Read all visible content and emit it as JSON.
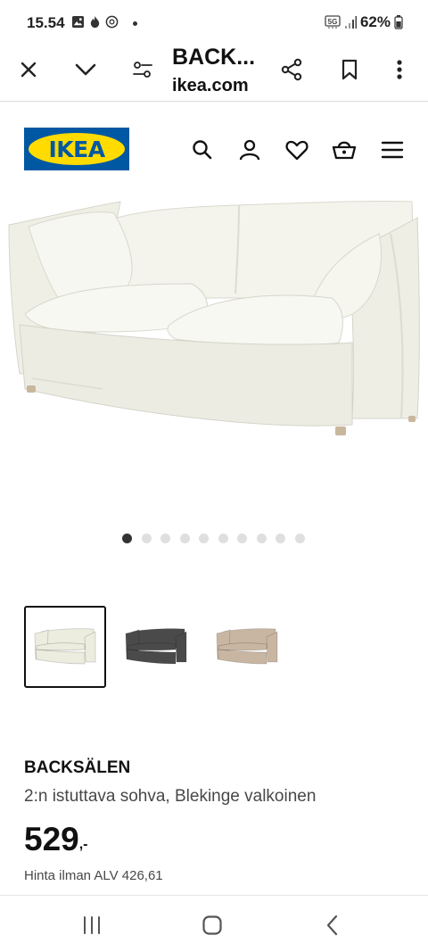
{
  "status_bar": {
    "time": "15.54",
    "network": "5G",
    "battery": "62%",
    "left_icons": [
      "gallery-icon",
      "fire-icon",
      "data-saver-icon"
    ],
    "right_icons": [
      "network-5g-icon",
      "signal-icon",
      "battery-icon"
    ]
  },
  "browser": {
    "title": "BACK...",
    "domain": "ikea.com",
    "icons": [
      "close-icon",
      "chevron-down-icon",
      "page-settings-icon",
      "share-icon",
      "bookmark-icon",
      "more-vert-icon"
    ]
  },
  "site_header": {
    "logo_text": "IKEA",
    "icons": [
      "search-icon",
      "user-icon",
      "heart-icon",
      "basket-icon",
      "menu-icon"
    ]
  },
  "carousel": {
    "total": 10,
    "active_index": 0
  },
  "variants": [
    {
      "color_name": "white",
      "color": "#ececdf",
      "selected": true
    },
    {
      "color_name": "dark grey",
      "color": "#4a4a4a",
      "selected": false
    },
    {
      "color_name": "beige",
      "color": "#c9b6a2",
      "selected": false
    }
  ],
  "product": {
    "name": "BACKSÄLEN",
    "description": "2:n istuttava sohva, Blekinge valkoinen",
    "price": "529",
    "price_suffix": ",-",
    "price_note": "Hinta ilman ALV 426,61"
  },
  "colors": {
    "ikea_blue": "#0058a3",
    "ikea_yellow": "#ffdb00",
    "sofa_white": "#ececdf"
  },
  "system_nav": {
    "icons": [
      "recent-apps-icon",
      "home-icon",
      "back-icon"
    ]
  }
}
